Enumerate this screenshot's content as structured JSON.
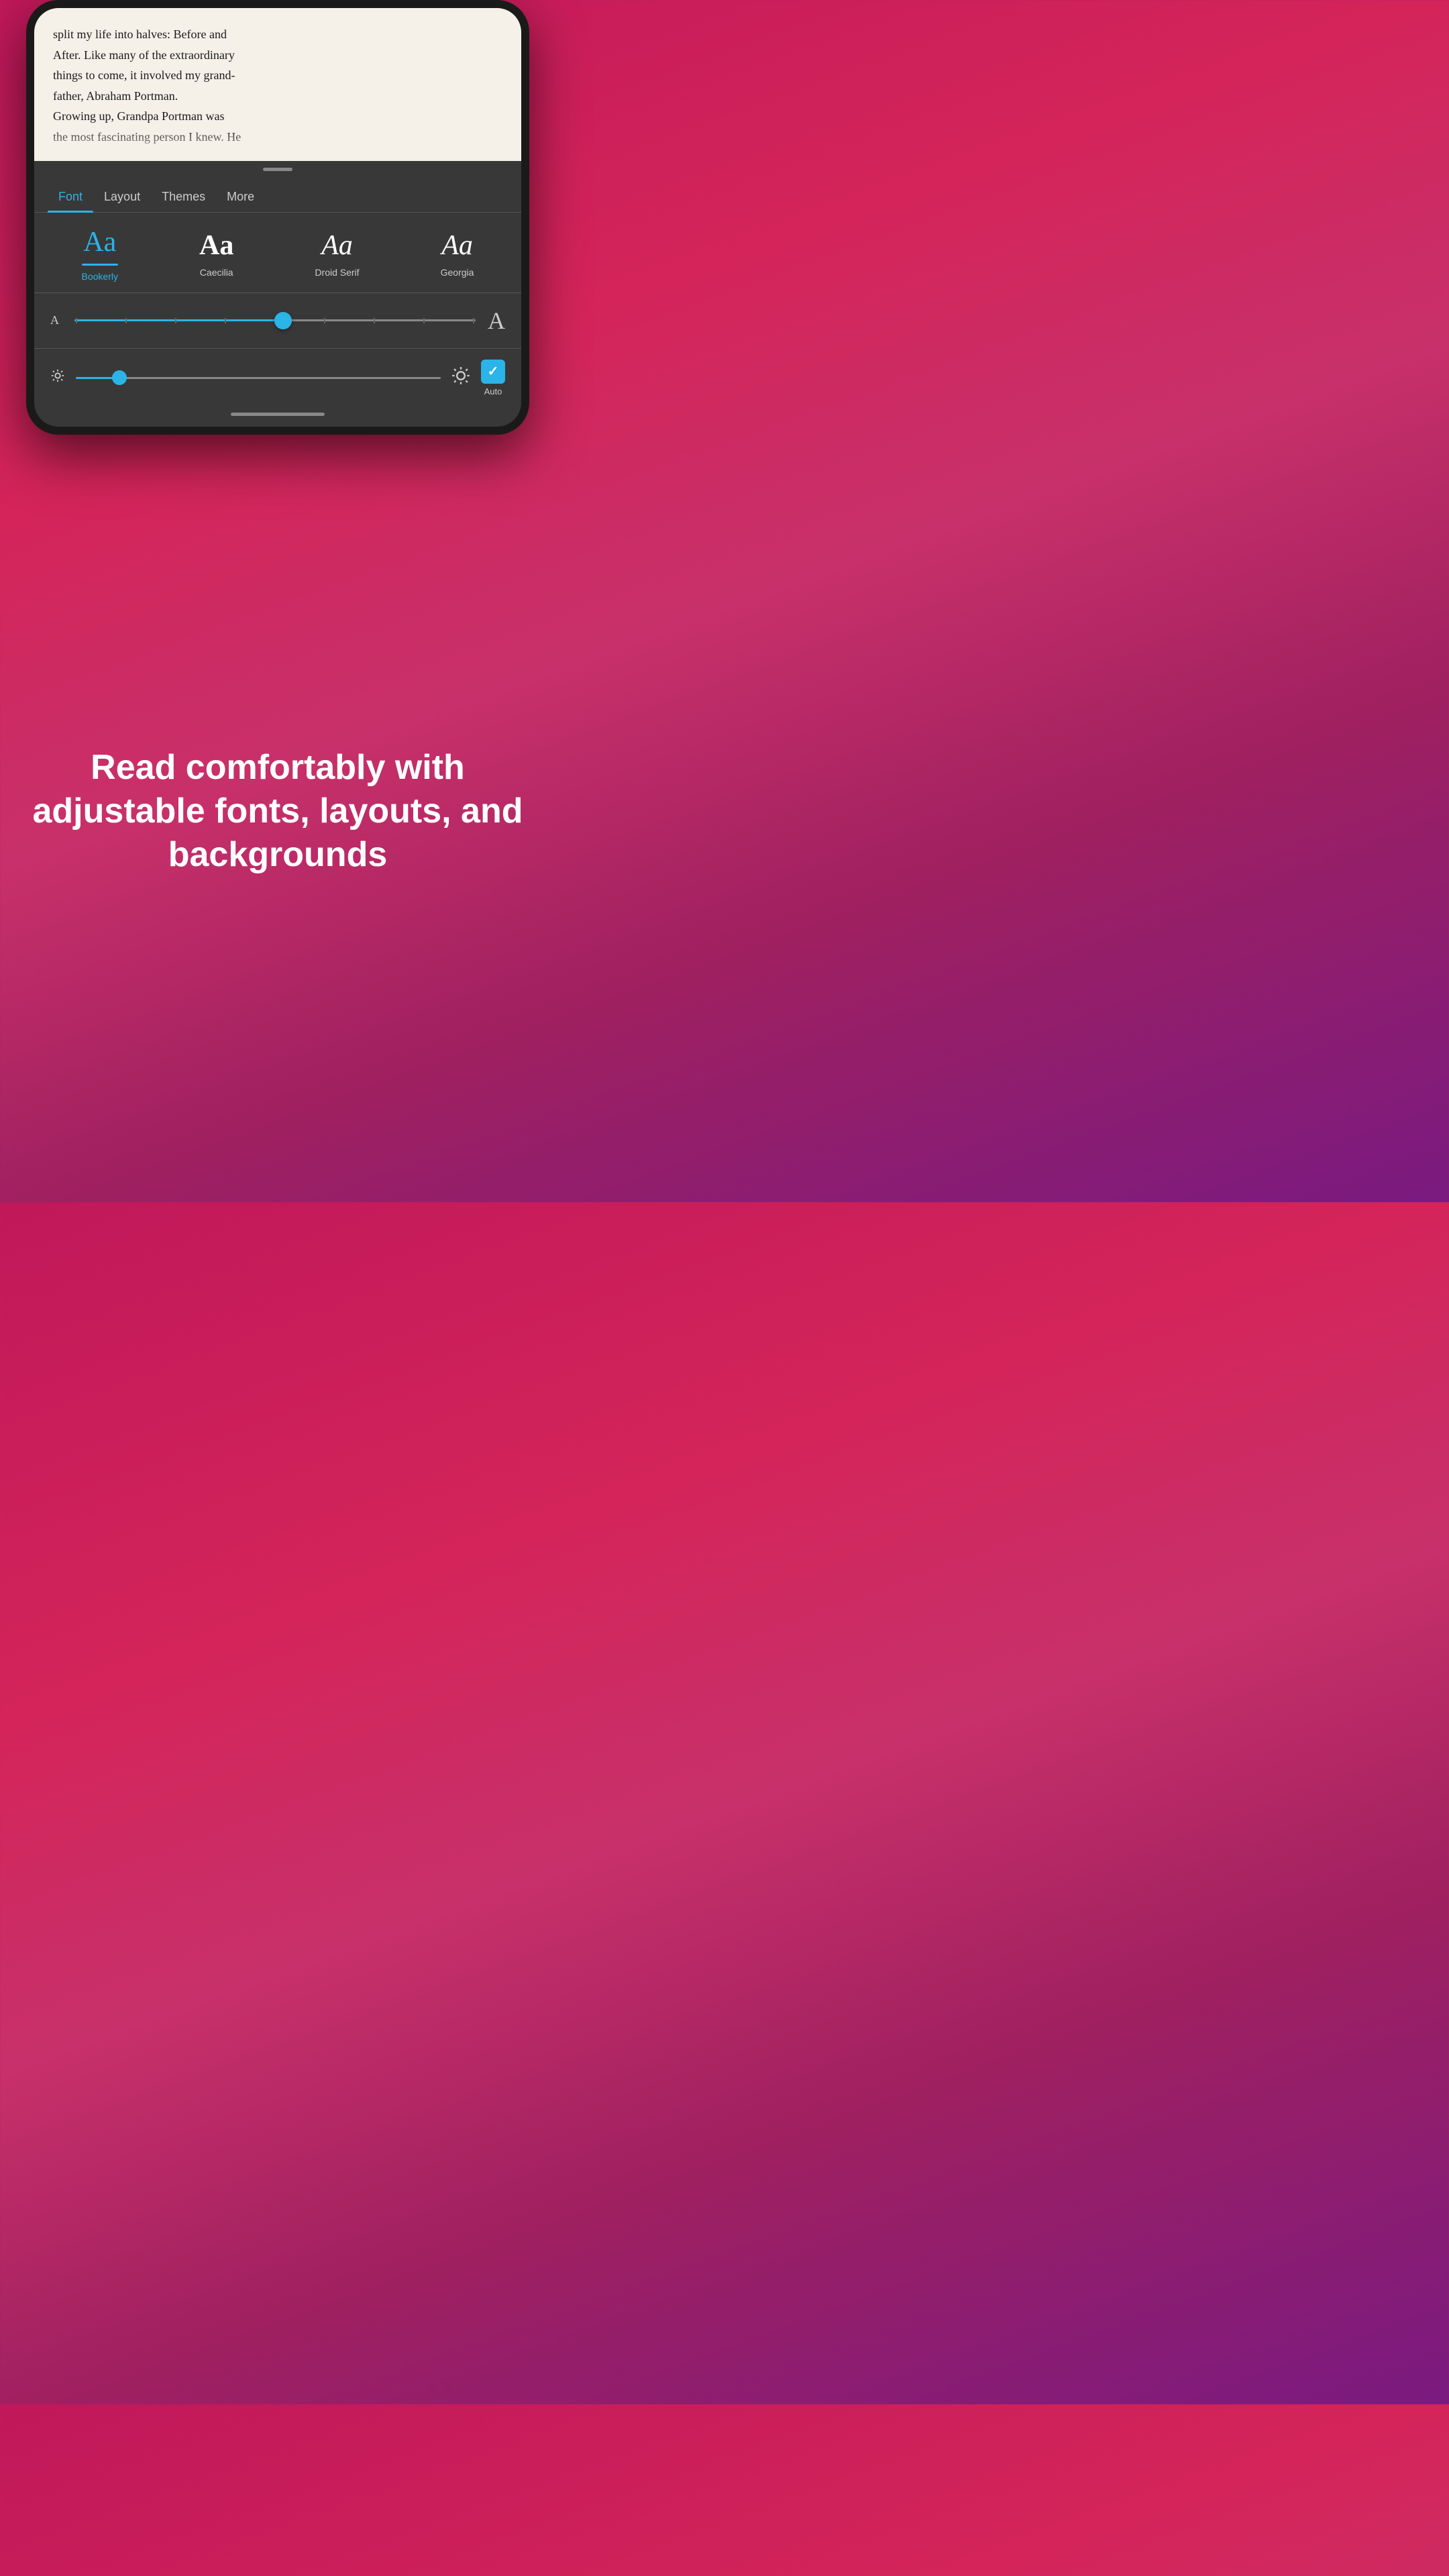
{
  "phone": {
    "book": {
      "text_line1": "split my life into halves: Before and",
      "text_line2": "After. Like many of the extraordinary",
      "text_line3": "things to come, it involved my grand-",
      "text_line4": "father, Abraham Portman.",
      "text_line5": "Growing up, Grandpa Portman was",
      "text_line6": "the most fascinating person I knew. He"
    },
    "tabs": [
      {
        "label": "Font",
        "active": true
      },
      {
        "label": "Layout",
        "active": false
      },
      {
        "label": "Themes",
        "active": false
      },
      {
        "label": "More",
        "active": false
      }
    ],
    "fonts": [
      {
        "name": "Bookerly",
        "preview": "Aa",
        "active": true
      },
      {
        "name": "Caecilia",
        "preview": "Aa",
        "active": false
      },
      {
        "name": "Droid Serif",
        "preview": "Aa",
        "active": false
      },
      {
        "name": "Georgia",
        "preview": "Aa",
        "active": false
      }
    ],
    "font_size": {
      "small_label": "A",
      "large_label": "A",
      "slider_percent": 52
    },
    "brightness": {
      "slider_percent": 12,
      "auto_label": "Auto"
    }
  },
  "promo": {
    "text": "Read comfortably with adjustable fonts, layouts, and backgrounds"
  }
}
